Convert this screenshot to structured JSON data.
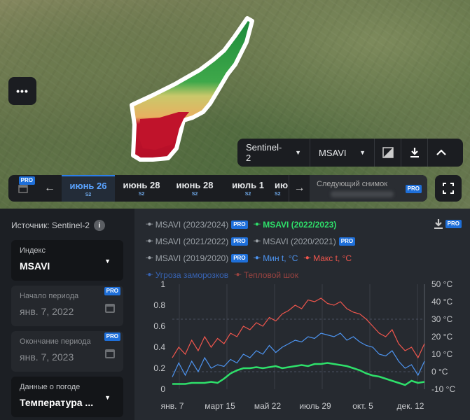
{
  "map": {
    "menu_label": "•••",
    "toolbar": {
      "satellite": "Sentinel-2",
      "index": "MSAVI"
    },
    "dates": [
      {
        "date": "июнь 26",
        "sat": "S2"
      },
      {
        "date": "июнь 28",
        "sat": "S2"
      },
      {
        "date": "июнь 28",
        "sat": "S2"
      },
      {
        "date": "июль 1",
        "sat": "S2"
      },
      {
        "date": "ию",
        "sat": "S2"
      }
    ],
    "next_snapshot": "Следующий снимок",
    "pro": "PRO"
  },
  "panel": {
    "source": "Источник: Sentinel-2",
    "info": "i",
    "index": {
      "label": "Индекс",
      "value": "MSAVI"
    },
    "start": {
      "label": "Начало периода",
      "value": "янв. 7, 2022"
    },
    "end": {
      "label": "Окончание периода",
      "value": "янв. 7, 2023"
    },
    "weather": {
      "label": "Данные о погоде",
      "value": "Температура ..."
    }
  },
  "legend": [
    {
      "text": "MSAVI (2023/2024)",
      "color": "#9aa0a6",
      "pro": true
    },
    {
      "text": "MSAVI (2022/2023)",
      "color": "#2ee06a",
      "pro": false
    },
    {
      "text": "MSAVI (2021/2022)",
      "color": "#9aa0a6",
      "pro": true
    },
    {
      "text": "MSAVI (2020/2021)",
      "color": "#9aa0a6",
      "pro": true
    },
    {
      "text": "MSAVI (2019/2020)",
      "color": "#9aa0a6",
      "pro": true
    },
    {
      "text": "Мин t, °C",
      "color": "#4d94f0",
      "pro": false
    },
    {
      "text": "Макс t, °C",
      "color": "#f0564d",
      "pro": false
    },
    {
      "text": "Угроза заморозков",
      "color": "#3763b3",
      "pro": false
    },
    {
      "text": "Тепловой шок",
      "color": "#9a4340",
      "pro": false
    }
  ],
  "chart_data": {
    "type": "line",
    "x_ticks": [
      "янв. 7",
      "март 15",
      "май 22",
      "июль 29",
      "окт. 5",
      "дек. 12"
    ],
    "y_left_ticks": [
      "0",
      "0.2",
      "0.4",
      "0.6",
      "0.8",
      "1"
    ],
    "y_right_ticks": [
      "-10 °C",
      "0 °C",
      "10 °C",
      "20 °C",
      "30 °C",
      "40 °C",
      "50 °C"
    ],
    "ylim_left": [
      0,
      1
    ],
    "ylim_right": [
      -10,
      50
    ],
    "frost_threshold_c": 0,
    "heat_threshold_c": 30,
    "series": [
      {
        "name": "MSAVI (2022/2023)",
        "color": "#2ee06a",
        "axis": "left",
        "values": [
          0.05,
          0.05,
          0.05,
          0.06,
          0.06,
          0.06,
          0.07,
          0.06,
          0.1,
          0.15,
          0.18,
          0.2,
          0.2,
          0.21,
          0.2,
          0.21,
          0.22,
          0.2,
          0.21,
          0.22,
          0.23,
          0.22,
          0.24,
          0.24,
          0.25,
          0.24,
          0.23,
          0.22,
          0.2,
          0.18,
          0.15,
          0.13,
          0.12,
          0.1,
          0.08,
          0.06,
          0.04,
          0.08,
          0.06,
          0.07
        ]
      },
      {
        "name": "Мин t, °C",
        "color": "#4d94f0",
        "axis": "right",
        "values": [
          -3,
          5,
          -2,
          6,
          0,
          8,
          2,
          4,
          3,
          7,
          5,
          10,
          8,
          12,
          10,
          15,
          11,
          14,
          16,
          18,
          17,
          20,
          19,
          22,
          21,
          20,
          22,
          18,
          20,
          17,
          15,
          14,
          10,
          9,
          12,
          6,
          2,
          4,
          -2,
          6
        ]
      },
      {
        "name": "Макс t, °C",
        "color": "#f0564d",
        "axis": "right",
        "values": [
          8,
          14,
          10,
          18,
          12,
          20,
          14,
          19,
          16,
          22,
          20,
          26,
          24,
          28,
          26,
          31,
          29,
          33,
          35,
          38,
          36,
          41,
          40,
          42,
          39,
          38,
          40,
          36,
          34,
          33,
          30,
          26,
          22,
          20,
          24,
          16,
          12,
          14,
          8,
          16
        ]
      }
    ]
  }
}
